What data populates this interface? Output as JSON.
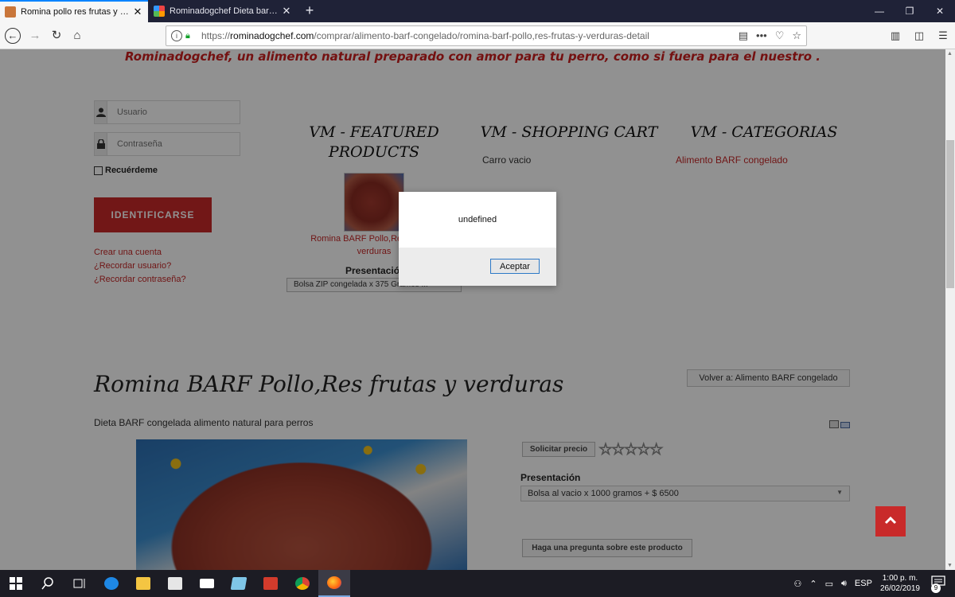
{
  "browser": {
    "tabs": [
      {
        "title": "Romina pollo res frutas y verdur",
        "active": true
      },
      {
        "title": "Rominadogchef Dieta barf Mer...",
        "active": false
      }
    ],
    "url_prefix": "https://",
    "url_domain": "rominadogchef.com",
    "url_path": "/comprar/alimento-barf-congelado/romina-barf-pollo,res-frutas-y-verduras-detail"
  },
  "page": {
    "tagline": "Rominadogchef, un alimento natural preparado con amor para tu perro, como si fuera para el  nuestro .",
    "login": {
      "username_placeholder": "Usuario",
      "password_placeholder": "Contraseña",
      "remember_label": "Recuérdeme",
      "login_button": "IDENTIFICARSE",
      "links": [
        "Crear una cuenta",
        "¿Recordar usuario?",
        "¿Recordar contraseña?"
      ]
    },
    "featured": {
      "title_line1": "VM - FEATURED",
      "title_line2": "PRODUCTS",
      "product_link_line1": "Romina BARF Pollo,Res frutas y",
      "product_link_line2": "verduras",
      "presentation_label": "Presentación",
      "selected_option": "Bolsa ZIP congelada x 375 Gramos ..."
    },
    "cart": {
      "title": "VM - SHOPPING CART",
      "status": "Carro vacio"
    },
    "categories": {
      "title": "VM - CATEGORIAS",
      "items": [
        "Alimento BARF congelado"
      ]
    },
    "product": {
      "title": "Romina BARF Pollo,Res frutas y verduras",
      "back_button": "Volver a: Alimento BARF congelado",
      "description": "Dieta BARF congelada alimento natural para perros",
      "price_button": "Solicitar precio",
      "rating_stars": 0,
      "rating_max": 5,
      "presentation_label": "Presentación",
      "selected_option": "Bolsa al vacio x 1000 gramos + $ 6500",
      "ask_button": "Haga una pregunta sobre este producto"
    }
  },
  "dialog": {
    "message": "undefined",
    "ok_button": "Aceptar"
  },
  "taskbar": {
    "language": "ESP",
    "time": "1:00 p. m.",
    "date": "26/02/2019",
    "notification_count": "9"
  },
  "colors": {
    "accent_red": "#c92a2a",
    "link_red": "#c62828",
    "tab_bar": "#1f2237",
    "taskbar": "#1c1c24"
  }
}
